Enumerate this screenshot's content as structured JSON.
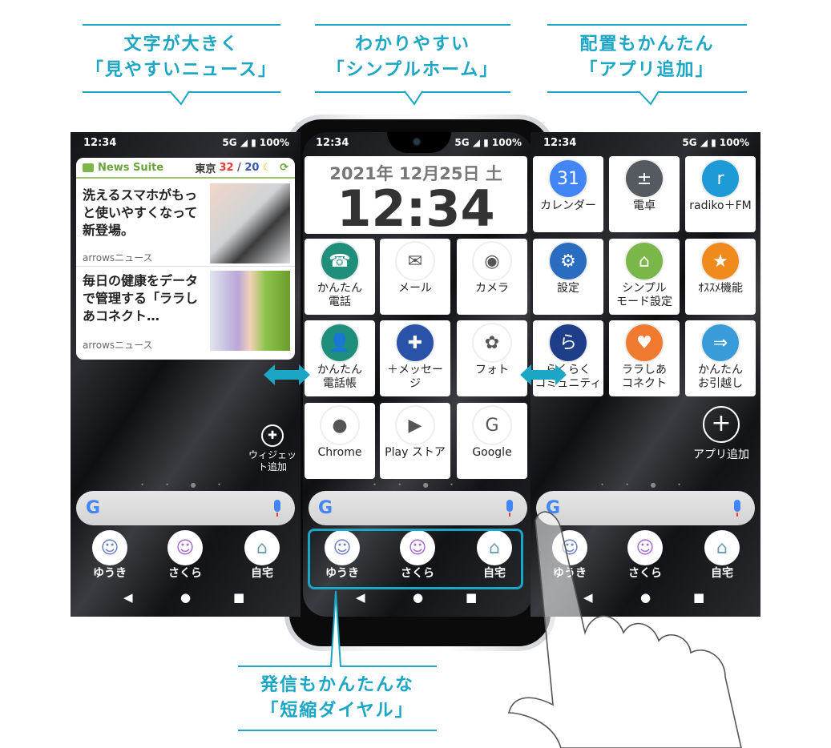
{
  "callouts": {
    "news": [
      "文字が大きく",
      "「見やすいニュース」"
    ],
    "home": [
      "わかりやすい",
      "「シンプルホーム」"
    ],
    "apps": [
      "配置もかんたん",
      "「アプリ追加」"
    ],
    "dial": [
      "発信もかんたんな",
      "「短縮ダイヤル」"
    ]
  },
  "accent_color": "#1aa6c4",
  "status": {
    "time": "12:34",
    "network": "5G ◢ ▮ 100%"
  },
  "news_screen": {
    "widget": {
      "app_name": "News Suite",
      "city": "東京",
      "temp_high": "32",
      "sep": " / ",
      "temp_low": "20",
      "weather_icon": "moon-icon",
      "refresh_icon": "refresh-icon",
      "articles": [
        {
          "headline": "洗えるスマホがもっと使いやすくなって新登場。",
          "source": "arrowsニュース"
        },
        {
          "headline": "毎日の健康をデータで管理する「ララしあコネクト…",
          "source": "arrowsニュース"
        }
      ]
    },
    "add_widget_label": "ウィジェット追加"
  },
  "home_screen": {
    "date": "2021年 12月25日 土",
    "clock": "12:34",
    "apps": [
      {
        "label": "かんたん\n電話",
        "icon": "phone-icon",
        "glyph": "☎",
        "color": "#1f8f7c"
      },
      {
        "label": "メール",
        "icon": "mail-icon",
        "glyph": "✉",
        "color": "#ffffff"
      },
      {
        "label": "カメラ",
        "icon": "camera-icon",
        "glyph": "◉",
        "color": "#ffffff"
      },
      {
        "label": "かんたん\n電話帳",
        "icon": "contacts-icon",
        "glyph": "👤",
        "color": "#1f8f7c"
      },
      {
        "label": "＋メッセー\nジ",
        "icon": "message-icon",
        "glyph": "✚",
        "color": "#2a52a8"
      },
      {
        "label": "フォト",
        "icon": "photos-icon",
        "glyph": "✿",
        "color": "#ffffff"
      },
      {
        "label": "Chrome",
        "icon": "chrome-icon",
        "glyph": "●",
        "color": "#ffffff"
      },
      {
        "label": "Play ストア",
        "icon": "play-store-icon",
        "glyph": "▶",
        "color": "#ffffff"
      },
      {
        "label": "Google",
        "icon": "google-folder-icon",
        "glyph": "G",
        "color": "#ffffff"
      }
    ]
  },
  "apps_screen": {
    "apps": [
      {
        "label": "カレンダー",
        "icon": "calendar-icon",
        "glyph": "31",
        "color": "#4285f4"
      },
      {
        "label": "電卓",
        "icon": "calculator-icon",
        "glyph": "±",
        "color": "#555a61"
      },
      {
        "label": "radiko＋FM",
        "icon": "radio-icon",
        "glyph": "r",
        "color": "#1e9bd7"
      },
      {
        "label": "設定",
        "icon": "settings-icon",
        "glyph": "⚙",
        "color": "#2a6cc0"
      },
      {
        "label": "シンプル\nモード設定",
        "icon": "home-icon",
        "glyph": "⌂",
        "color": "#7ab648"
      },
      {
        "label": "ｵｽｽﾒ機能",
        "icon": "star-icon",
        "glyph": "★",
        "color": "#f08a1c"
      },
      {
        "label": "らくらく\nコミュニティ",
        "icon": "community-icon",
        "glyph": "ら",
        "color": "#1f3e8a"
      },
      {
        "label": "ララしあ\nコネクト",
        "icon": "heart-icon",
        "glyph": "♥",
        "color": "#f07a30"
      },
      {
        "label": "かんたん\nお引越し",
        "icon": "transfer-icon",
        "glyph": "⇒",
        "color": "#3a9bd9"
      }
    ],
    "add_app_label": "アプリ追加"
  },
  "dock": [
    {
      "label": "ゆうき",
      "icon": "person-male-icon",
      "color": "#6b7fc4"
    },
    {
      "label": "さくら",
      "icon": "person-female-icon",
      "color": "#a56ad0"
    },
    {
      "label": "自宅",
      "icon": "house-icon",
      "color": "#6c9bb0"
    }
  ],
  "nav": {
    "back": "◀",
    "home": "●",
    "recents": "■"
  }
}
